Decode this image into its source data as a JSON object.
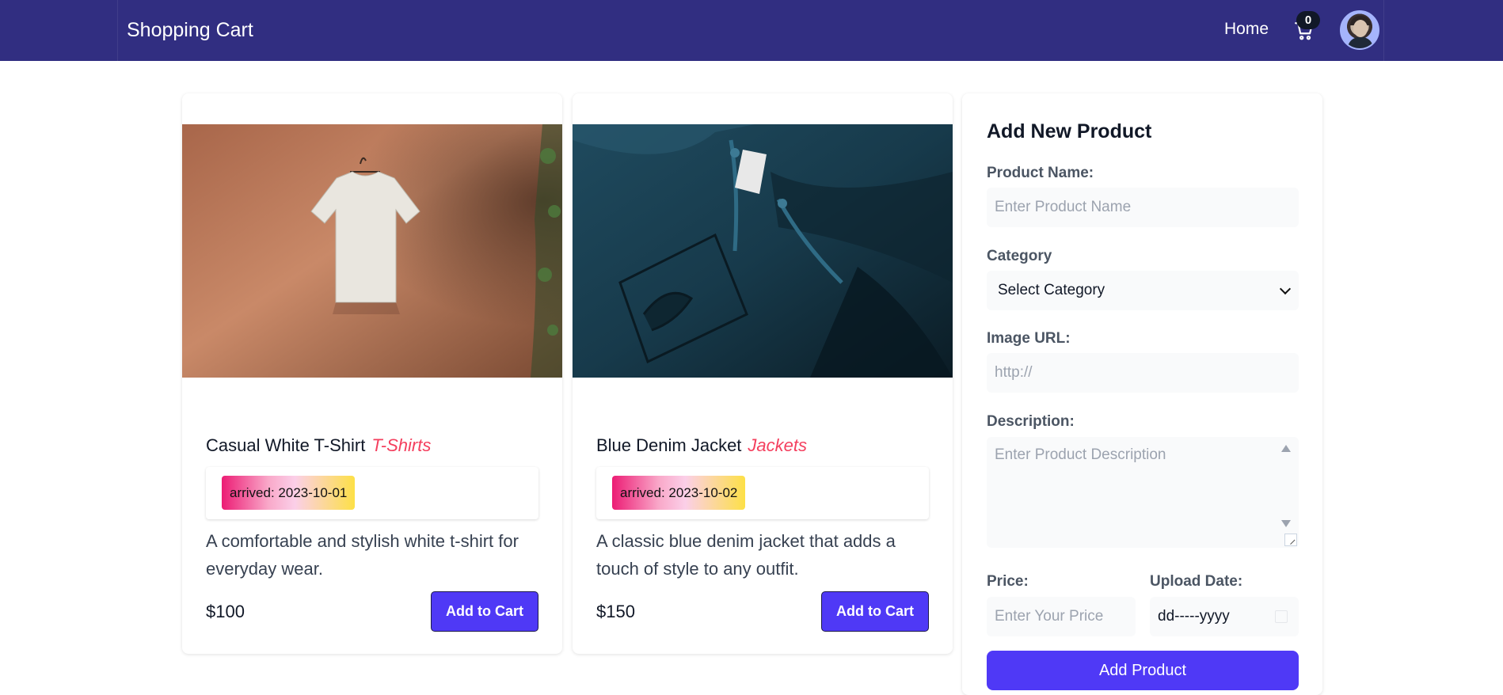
{
  "app": {
    "title": "Shopping Cart"
  },
  "nav": {
    "home_label": "Home",
    "cart_count": "0"
  },
  "products": [
    {
      "name": "Casual White T-Shirt",
      "category": "T-Shirts",
      "arrived": "arrived: 2023-10-01",
      "description": "A comfortable and stylish white t-shirt for everyday wear.",
      "price": "$100",
      "button_label": "Add to Cart"
    },
    {
      "name": "Blue Denim Jacket",
      "category": "Jackets",
      "arrived": "arrived: 2023-10-02",
      "description": "A classic blue denim jacket that adds a touch of style to any outfit.",
      "price": "$150",
      "button_label": "Add to Cart"
    }
  ],
  "form": {
    "title": "Add New Product",
    "name_label": "Product Name:",
    "name_placeholder": "Enter Product Name",
    "category_label": "Category",
    "category_selected": "Select Category",
    "image_label": "Image URL:",
    "image_placeholder": "http://",
    "description_label": "Description:",
    "description_placeholder": "Enter Product Description",
    "price_label": "Price:",
    "price_placeholder": "Enter Your Price",
    "date_label": "Upload Date:",
    "date_value": "dd-----yyyy",
    "submit_label": "Add Product"
  },
  "colors": {
    "navbar": "#312e81",
    "accent": "#4f39f6",
    "category": "#f43f5e"
  }
}
